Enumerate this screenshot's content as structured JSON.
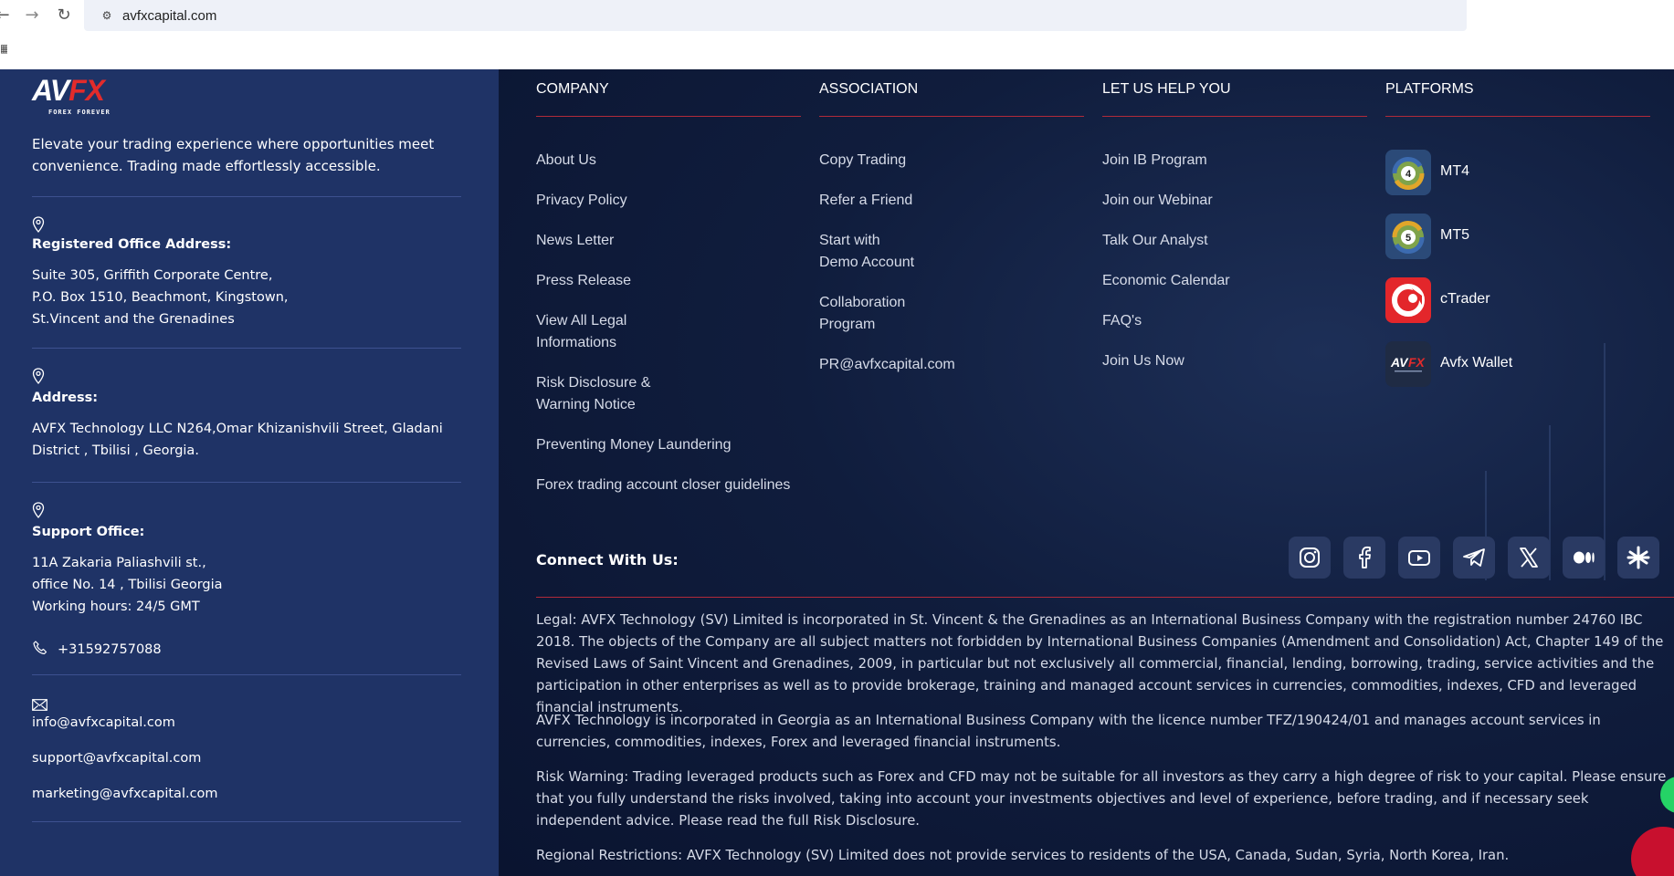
{
  "browser": {
    "url": "avfxcapital.com"
  },
  "brand": {
    "logo_av": "AV",
    "logo_fx": "FX",
    "logo_tagline": "FOREX FOREVER",
    "red": "#e32b2b",
    "navy": "#1f3366"
  },
  "left": {
    "intro": "Elevate your trading experience where opportunities meet convenience. Trading made effortlessly accessible.",
    "registered": {
      "title": "Registered Office Address:",
      "lines": [
        "Suite 305, Griffith Corporate Centre,",
        "P.O. Box 1510, Beachmont, Kingstown,",
        "St.Vincent and the Grenadines"
      ]
    },
    "address": {
      "title": "Address:",
      "lines": [
        "AVFX Technology LLC N264,Omar Khizanishvili Street, Gladani",
        "District , Tbilisi , Georgia."
      ]
    },
    "support": {
      "title": "Support Office:",
      "lines": [
        "11A Zakaria Paliashvili st.,",
        "office No. 14 , Tbilisi Georgia",
        "Working hours: 24/5 GMT"
      ]
    },
    "phone": "+31592757088",
    "emails": [
      "info@avfxcapital.com",
      "support@avfxcapital.com",
      "marketing@avfxcapital.com"
    ]
  },
  "columns": {
    "company": {
      "heading": "COMPANY",
      "links": [
        "About Us",
        "Privacy Policy",
        "News Letter",
        "Press Release",
        "View All Legal\nInformations",
        "Risk Disclosure &\nWarning Notice",
        "Preventing Money Laundering",
        "Forex trading account closer guidelines"
      ]
    },
    "association": {
      "heading": "ASSOCIATION",
      "links": [
        "Copy Trading",
        "Refer a Friend",
        "Start with\nDemo Account",
        "Collaboration\nProgram",
        "PR@avfxcapital.com"
      ]
    },
    "help": {
      "heading": "LET US HELP YOU",
      "links": [
        "Join IB Program",
        "Join our Webinar",
        "Talk Our Analyst",
        "Economic Calendar",
        "FAQ's",
        "Join Us Now"
      ]
    },
    "platforms": {
      "heading": "PLATFORMS",
      "items": [
        {
          "label": "MT4",
          "icon": "mt4-icon"
        },
        {
          "label": "MT5",
          "icon": "mt5-icon"
        },
        {
          "label": "cTrader",
          "icon": "ctrader-icon"
        },
        {
          "label": "Avfx Wallet",
          "icon": "avfx-wallet-icon"
        }
      ]
    }
  },
  "connect": {
    "label": "Connect With Us:",
    "socials": [
      "instagram-icon",
      "facebook-icon",
      "youtube-icon",
      "telegram-icon",
      "x-icon",
      "medium-icon",
      "linktree-icon"
    ]
  },
  "legal": [
    "Legal: AVFX Technology (SV) Limited is incorporated in St. Vincent & the Grenadines as an International Business Company with the registration number 24760 IBC 2018. The objects of the Company are all subject matters not forbidden by International Business Companies (Amendment and Consolidation) Act, Chapter 149 of the Revised Laws of Saint Vincent and Grenadines, 2009, in particular but not exclusively all commercial, financial, lending, borrowing, trading, service activities and the participation in other enterprises as well as to provide brokerage, training and managed account services in currencies, commodities, indexes, CFD and leveraged financial instruments.",
    "AVFX Technology is incorporated in Georgia as an International Business Company with the licence number TFZ/190424/01 and manages account services in currencies, commodities, indexes, Forex and leveraged financial instruments.",
    "Risk Warning: Trading leveraged products such as Forex and CFD may not be suitable for all investors as they carry a high degree of risk to your capital. Please ensure that you fully understand the risks involved, taking into account your investments objectives and level of experience, before trading, and if necessary seek independent advice. Please read the full Risk Disclosure.",
    "Regional Restrictions: AVFX Technology (SV) Limited does not provide services to residents of the USA, Canada, Sudan, Syria, North Korea, Iran."
  ]
}
